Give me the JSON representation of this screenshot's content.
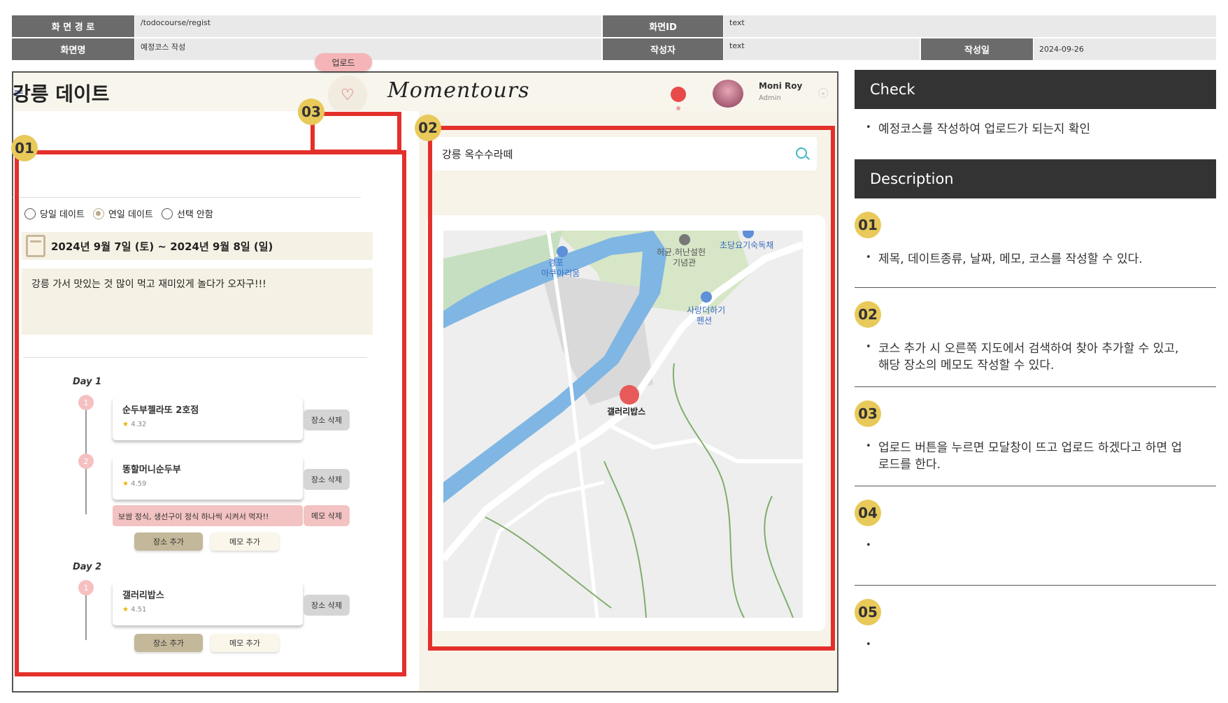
{
  "header": {
    "path_label": "화 면 경 로",
    "path_value": "/todocourse/regist",
    "screen_id_label": "화면ID",
    "screen_id_value": "text",
    "screen_name_label": "화면명",
    "screen_name_value": "예정코스 작성",
    "author_label": "작성자",
    "author_value": "text",
    "date_label": "작성일",
    "date_value": "2024-09-26"
  },
  "app": {
    "logo_text": "Momentours",
    "user_name": "Moni Roy",
    "user_role": "Admin",
    "upload_label": "업로드",
    "course_title": "강릉 데이트",
    "radio_options": [
      {
        "label": "당일 데이트",
        "selected": false
      },
      {
        "label": "연일 데이트",
        "selected": true
      },
      {
        "label": "선택 안함",
        "selected": false
      }
    ],
    "date_range": "2024년 9월 7일 (토) ~ 2024년 9월 8일 (일)",
    "memo": "강릉 가서 맛있는 것 많이 먹고 재미있게 놀다가 오자구!!!",
    "day1_label": "Day 1",
    "day2_label": "Day 2",
    "day1_places": [
      {
        "num": "1",
        "name": "순두부젤라또 2호점",
        "rating": "4.32",
        "delete": "장소 삭제"
      },
      {
        "num": "2",
        "name": "똥할머니순두부",
        "rating": "4.59",
        "delete": "장소 삭제"
      }
    ],
    "day1_memo": "보쌈 정식, 생선구이 정식 하나씩 시켜서 먹자!!",
    "memo_delete": "메모 삭제",
    "day2_places": [
      {
        "num": "1",
        "name": "갤러리밥스",
        "rating": "4.51",
        "delete": "장소 삭제"
      }
    ],
    "add_place": "장소 추가",
    "add_memo": "메모 추가",
    "search_value": "강릉 옥수수라떼",
    "map_labels": {
      "place1": "경포\n아쿠아리움",
      "place2": "허균.허난설헌\n기념관",
      "place3": "초당요기숙독채",
      "place4": "사랑더하기\n펜션",
      "marker": "갤러리밥스"
    }
  },
  "badges": [
    "01",
    "02",
    "03"
  ],
  "panel": {
    "check_title": "Check",
    "check_text": "예정코스를 작성하여 업로드가 되는지 확인",
    "description_title": "Description",
    "items": [
      {
        "num": "01",
        "text": "제목, 데이트종류, 날짜, 메모, 코스를 작성할 수 있다."
      },
      {
        "num": "02",
        "text": "코스 추가 시 오른쪽 지도에서 검색하여 찾아 추가할 수 있고, 해당 장소의 메모도 작성할 수 있다."
      },
      {
        "num": "03",
        "text": "업로드 버튼을 누르면 모달창이 뜨고 업로드 하겠다고 하면 업로드를 한다."
      },
      {
        "num": "04",
        "text": ""
      },
      {
        "num": "05",
        "text": ""
      }
    ]
  },
  "colors": {
    "annotation_red": "#e4302a",
    "badge_yellow": "#e8c95a",
    "header_gray": "#6b6b6b",
    "panel_dark": "#333333"
  }
}
